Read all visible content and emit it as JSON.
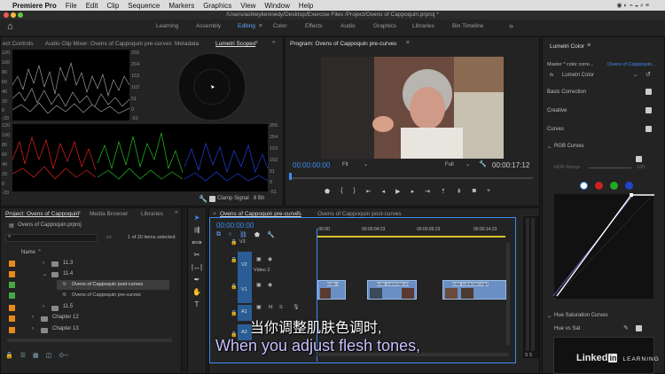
{
  "menubar": {
    "apple": "",
    "items": [
      "Premiere Pro",
      "File",
      "Edit",
      "Clip",
      "Sequence",
      "Markers",
      "Graphics",
      "View",
      "Window",
      "Help"
    ]
  },
  "titlebar": {
    "path": "/Users/ashleykennedy/Desktop/Exercise Files /Project/Ovens of Cappoquin.prproj *"
  },
  "workspaces": [
    "Learning",
    "Assembly",
    "Editing",
    "Color",
    "Effects",
    "Audio",
    "Graphics",
    "Libraries",
    "Bin Timeline"
  ],
  "active_workspace": "Editing",
  "source_tabs": [
    "ect Controls",
    "Audio Clip Mixer: Ovens of Cappoquin pre-curves",
    "Metadata",
    "Lumetri Scopes"
  ],
  "scope": {
    "top_left_ticks": [
      "120",
      "100",
      "80",
      "60",
      "40",
      "20",
      "0",
      "-20"
    ],
    "top_right_ticks": [
      "255",
      "204",
      "153",
      "102",
      "51",
      "0",
      "-51"
    ],
    "bottom_left_ticks": [
      "120",
      "100",
      "80",
      "60",
      "40",
      "20",
      "0",
      "-20"
    ],
    "bottom_right_ticks": [
      "255",
      "204",
      "153",
      "102",
      "51",
      "0",
      "-51"
    ],
    "clamp_signal": "Clamp Signal",
    "bit_depth": "8 Bit"
  },
  "program": {
    "tab": "Program: Ovens of Cappoquin pre-curves",
    "timecode": "00:00:00:00",
    "fit": "Fit",
    "resolution": "Full",
    "duration": "00:00:17:12"
  },
  "lumetri": {
    "title": "Lumetri Color",
    "master": "Master * color corre...",
    "clip": "Ovens of Cappoquin...",
    "fx": "fx",
    "fx_name": "Lumetri Color",
    "sections": [
      "Basic Correction",
      "Creative",
      "Curves"
    ],
    "rgb_curves": "RGB Curves",
    "hdr_range": "HDR Range",
    "hdr_value": "100",
    "hue_curves": "Hue Saturation Curves",
    "hue_vs_sat": "Hue vs Sat",
    "dot_colors": [
      "#ffffff",
      "#cc2222",
      "#22aa22",
      "#2244cc"
    ]
  },
  "project": {
    "tabs": [
      "Project: Ovens of Cappoquin",
      "Media Browser",
      "Libraries"
    ],
    "file": "Ovens of Cappoquin.prproj",
    "count": "1 of 20 items selected",
    "name_col": "Name",
    "items": [
      {
        "label": "11.3",
        "kind": "bin",
        "color": "#e88a1a"
      },
      {
        "label": "11.4",
        "kind": "bin",
        "color": "#e88a1a"
      },
      {
        "label": "Ovens of Cappoquin post-curves",
        "kind": "seq",
        "color": "#45a845"
      },
      {
        "label": "Ovens of Cappoquin pre-curves",
        "kind": "seq",
        "color": "#45a845"
      },
      {
        "label": "11.5",
        "kind": "bin",
        "color": "#e88a1a"
      },
      {
        "label": "Chapter 12",
        "kind": "bin",
        "color": "#e88a1a"
      },
      {
        "label": "Chapter 13",
        "kind": "bin",
        "color": "#e88a1a"
      }
    ]
  },
  "timeline": {
    "tabs": [
      "Ovens of Cappoquin pre-curves",
      "Ovens of Cappoquin post-curves"
    ],
    "timecode": "00:00:00:00",
    "ruler": [
      ":00:00",
      "00:00:04:23",
      "00:00:09:23",
      "00:00:14:23"
    ],
    "tracks": {
      "v3": "V3",
      "v2": "V2",
      "v2_name": "Video 2",
      "v1": "V1",
      "a1": "A1",
      "a2": "A2",
      "m": "M",
      "s": "S"
    },
    "clips": [
      "color c",
      "color correction.m",
      "color correction.mp4"
    ]
  },
  "subtitles": {
    "zh": "当你调整肌肤色调时,",
    "en": "When you adjust flesh tones,"
  },
  "watermark": {
    "brand": "Linked",
    "in": "in",
    "learning": "LEARNING"
  }
}
